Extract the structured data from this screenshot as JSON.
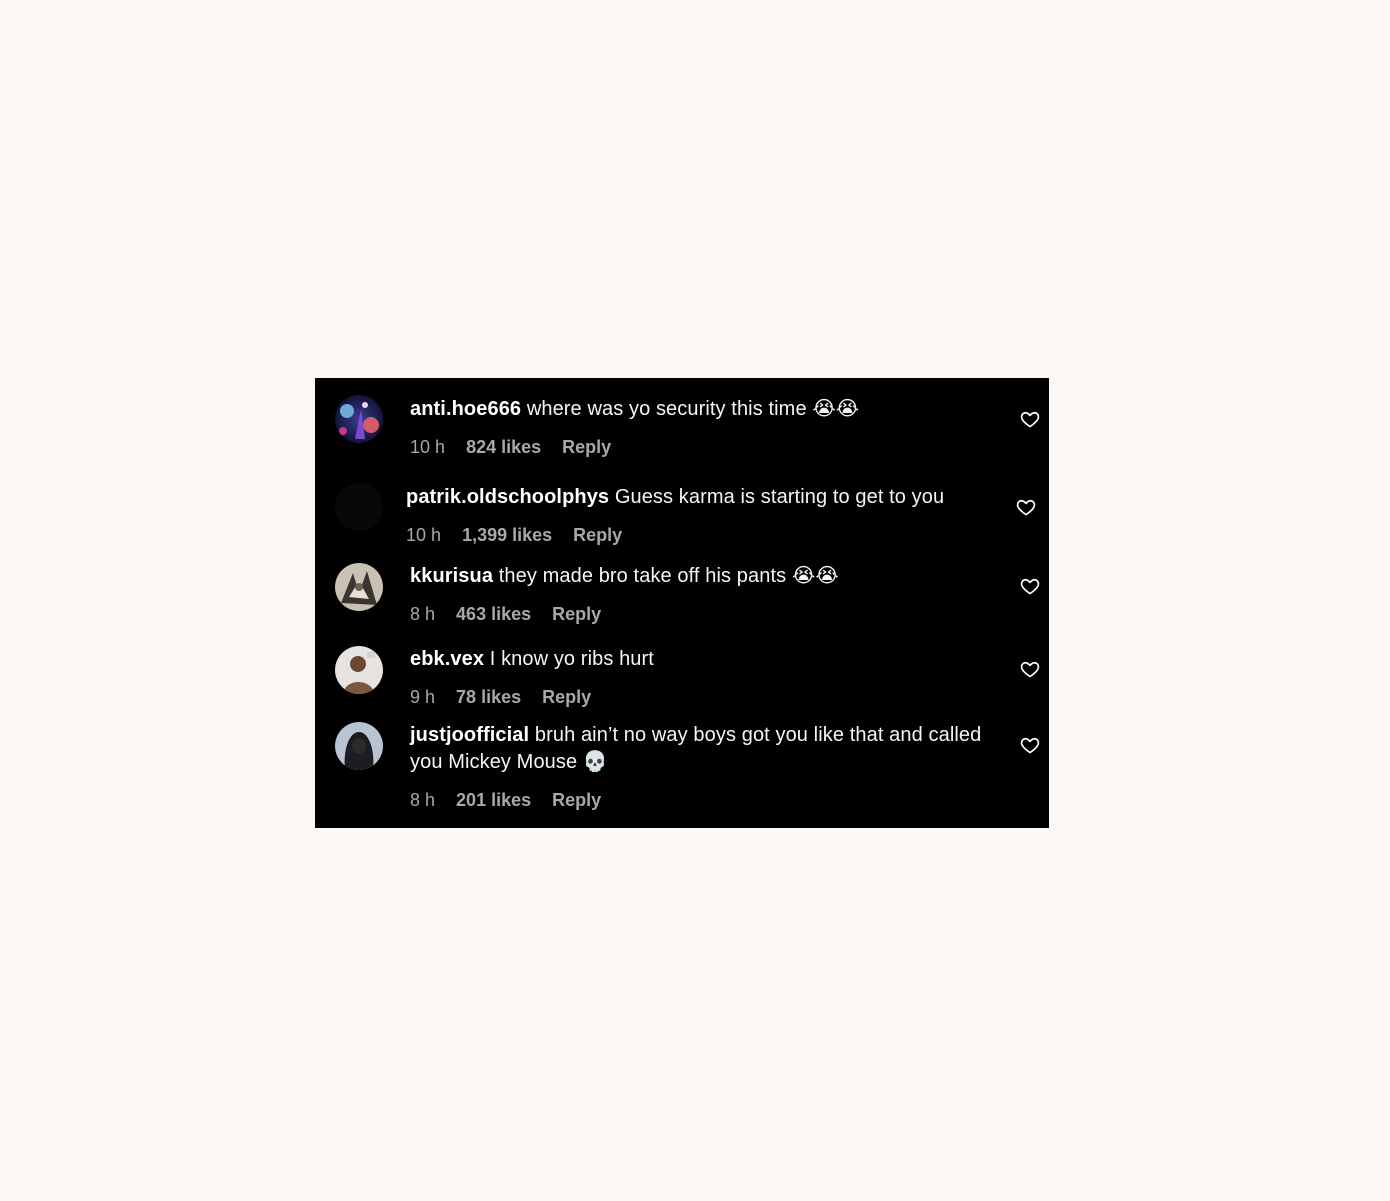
{
  "comments": [
    {
      "username": "anti.hoe666",
      "text": "where was yo security this time 😭😭",
      "time": "10 h",
      "likes": "824 likes",
      "reply": "Reply",
      "avatar_icon": "galaxy-art-avatar"
    },
    {
      "username": "patrik.oldschoolphys",
      "text": "Guess karma is starting to get to you",
      "time": "10 h",
      "likes": "1,399 likes",
      "reply": "Reply",
      "avatar_icon": "dark-avatar"
    },
    {
      "username": "kkurisua",
      "text": "they made bro take off his pants 😭😭",
      "time": "8 h",
      "likes": "463 likes",
      "reply": "Reply",
      "avatar_icon": "manga-avatar"
    },
    {
      "username": "ebk.vex",
      "text": "I know yo ribs hurt",
      "time": "9 h",
      "likes": "78 likes",
      "reply": "Reply",
      "avatar_icon": "person-photo-avatar"
    },
    {
      "username": "justjoofficial",
      "text": "bruh ain’t no way boys got you like that and called you Mickey Mouse 💀",
      "time": "8 h",
      "likes": "201 likes",
      "reply": "Reply",
      "avatar_icon": "hooded-person-avatar"
    }
  ],
  "colors": {
    "page_background": "#fbf8f6",
    "panel_background": "#000000",
    "text": "#f5f5f5",
    "meta": "#a8a8a8"
  }
}
